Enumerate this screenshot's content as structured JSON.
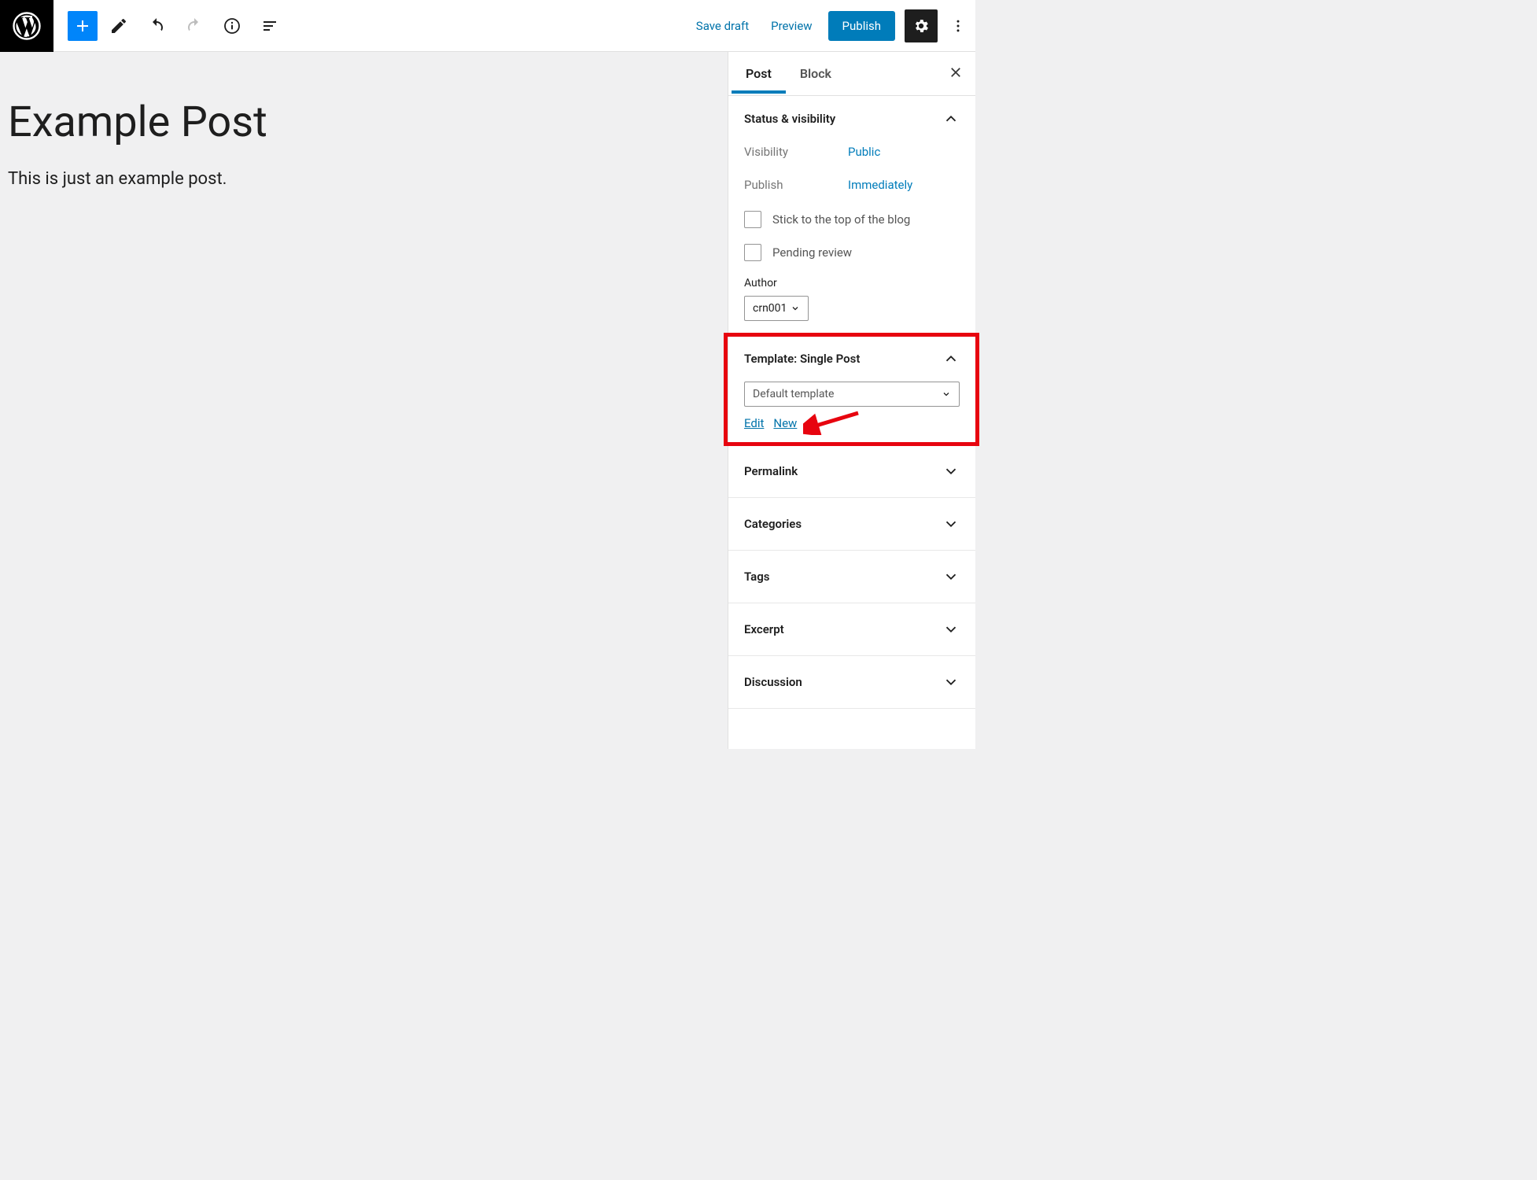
{
  "toolbar": {
    "save_draft": "Save draft",
    "preview": "Preview",
    "publish": "Publish"
  },
  "post": {
    "title": "Example Post",
    "body": "This is just an example post."
  },
  "sidebar": {
    "tabs": {
      "post": "Post",
      "block": "Block"
    },
    "status": {
      "title": "Status & visibility",
      "visibility_label": "Visibility",
      "visibility_value": "Public",
      "publish_label": "Publish",
      "publish_value": "Immediately",
      "sticky_label": "Stick to the top of the blog",
      "pending_label": "Pending review",
      "author_label": "Author",
      "author_value": "crn001"
    },
    "template": {
      "title": "Template: Single Post",
      "selected": "Default template",
      "edit": "Edit",
      "new": "New"
    },
    "panels": {
      "permalink": "Permalink",
      "categories": "Categories",
      "tags": "Tags",
      "excerpt": "Excerpt",
      "discussion": "Discussion"
    }
  }
}
